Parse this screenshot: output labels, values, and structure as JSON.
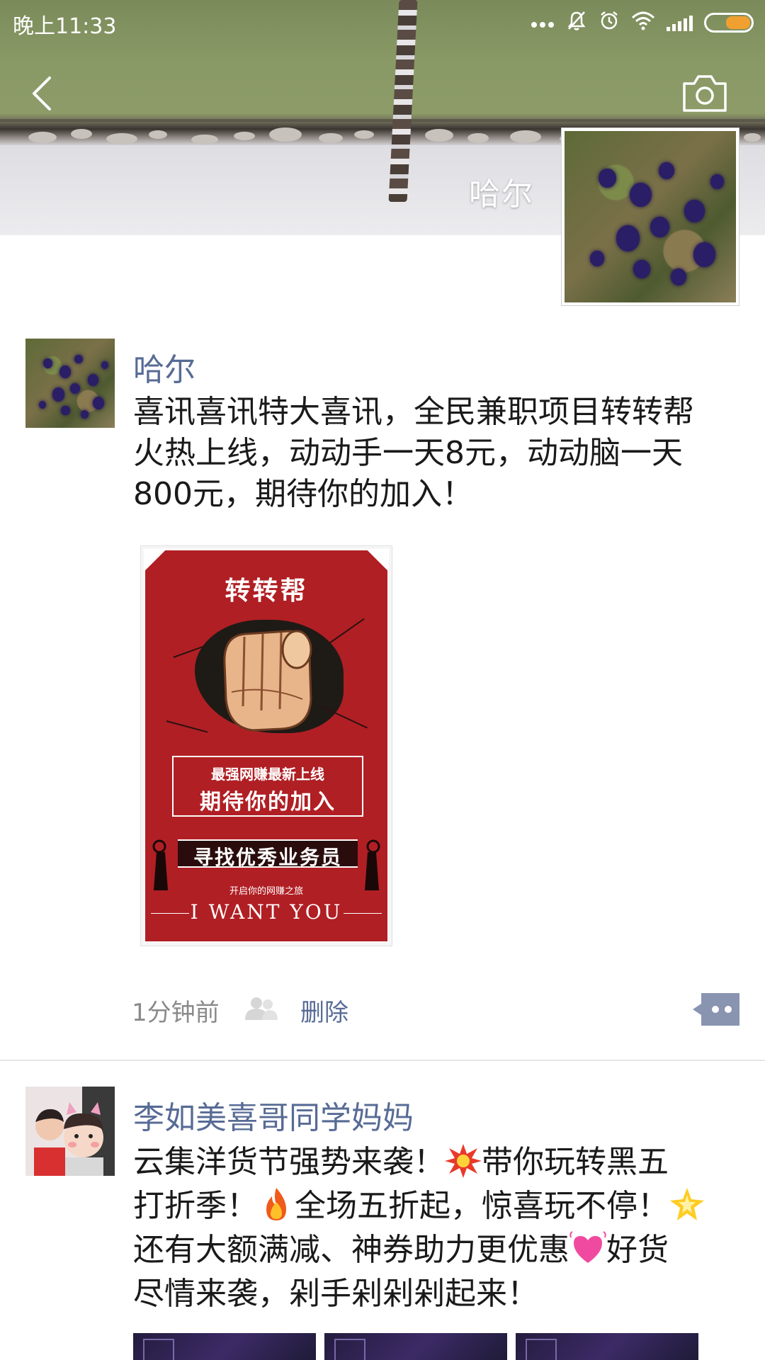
{
  "status_bar": {
    "time": "晚上11:33",
    "icons": [
      "more-dots-icon",
      "mute-bell-icon",
      "alarm-icon",
      "wifi-icon",
      "signal-icon",
      "battery-icon"
    ]
  },
  "header": {
    "back_icon": "chevron-left-icon",
    "camera_icon": "camera-icon"
  },
  "cover": {
    "user_name": "哈尔"
  },
  "posts": [
    {
      "author": "哈尔",
      "text_lines": [
        "喜讯喜讯特大喜讯，全民兼职项目转转帮",
        "火热上线，动动手一天8元，动动脑一天",
        "800元，期待你的加入！"
      ],
      "poster": {
        "title": "转转帮",
        "box_line1": "最强网赚最新上线",
        "box_line2": "期待你的加入",
        "band": "寻找优秀业务员",
        "small": "开启你的网赚之旅",
        "english": "I WANT YOU"
      },
      "time": "1分钟前",
      "delete_label": "删除"
    },
    {
      "author": "李如美喜哥同学妈妈",
      "text_lines": [
        [
          "云集洋货节强势来袭！",
          "collision-emoji",
          "带你玩转黑五"
        ],
        [
          "打折季！",
          "fire-emoji",
          "全场五折起，惊喜玩不停！",
          "sparkle-star-emoji"
        ],
        [
          "还有大额满减、神券助力更优惠",
          "beating-heart-emoji",
          "好货"
        ],
        [
          "尽情来袭，剁手剁剁剁起来！"
        ]
      ]
    }
  ],
  "colors": {
    "link": "#576b95",
    "text": "#1a1a1a",
    "meta": "#8a8a8a",
    "poster_red": "#b01f24",
    "battery": "#f0a030"
  }
}
